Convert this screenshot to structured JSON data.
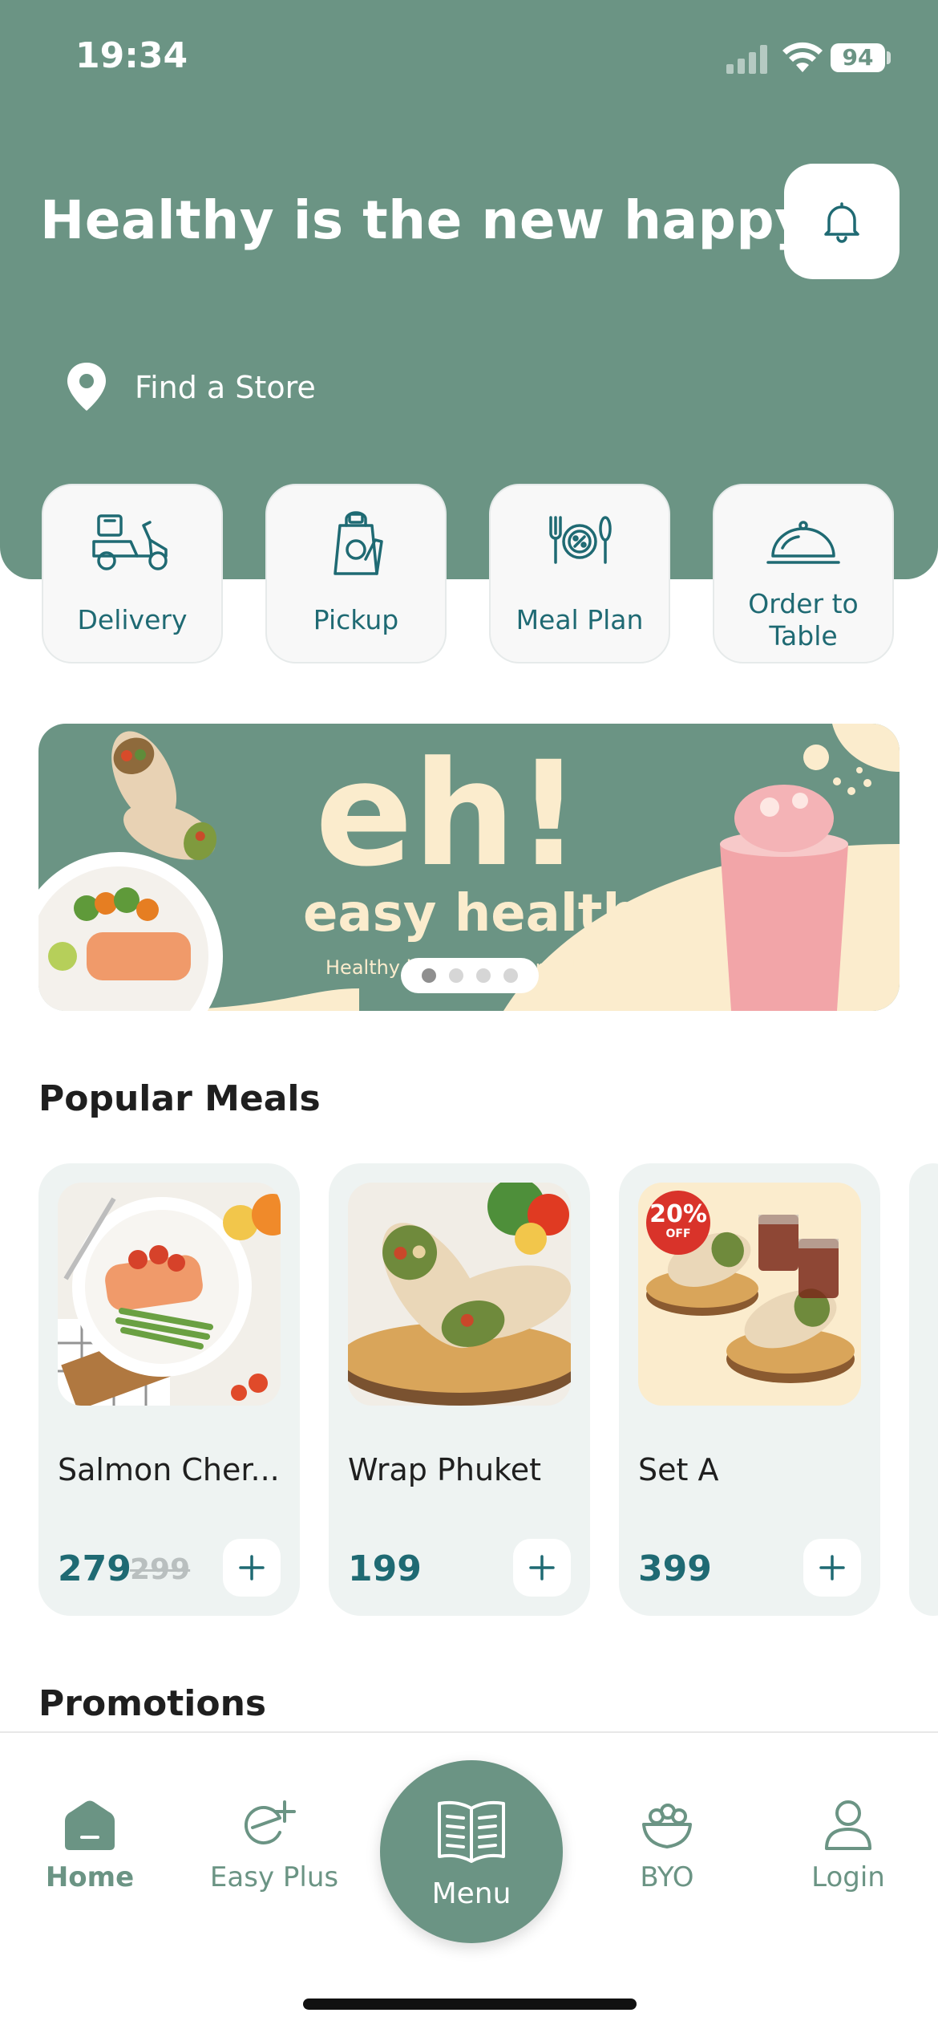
{
  "status_bar": {
    "time": "19:34",
    "battery": "94"
  },
  "header": {
    "headline": "Healthy is the new happy!",
    "find_store": "Find a Store"
  },
  "services": [
    {
      "label": "Delivery",
      "icon": "scooter-icon"
    },
    {
      "label": "Pickup",
      "icon": "bag-icon"
    },
    {
      "label": "Meal Plan",
      "icon": "meal-plan-icon"
    },
    {
      "label": "Order to Table",
      "icon": "cloche-icon"
    }
  ],
  "banner": {
    "brand": "eh!",
    "title": "easy health",
    "tagline": "Healthy is the new happy!",
    "slides": 4,
    "active_slide": 1
  },
  "popular": {
    "title": "Popular Meals",
    "items": [
      {
        "name": "Salmon Cher...",
        "price": "279",
        "old_price": "299"
      },
      {
        "name": "Wrap Phuket",
        "price": "199"
      },
      {
        "name": "Set A",
        "price": "399",
        "badge_pct": "20%",
        "badge_off": "OFF"
      }
    ]
  },
  "promotions": {
    "title": "Promotions"
  },
  "tabbar": {
    "home": "Home",
    "easy_plus": "Easy Plus",
    "menu": "Menu",
    "byo": "BYO",
    "login": "Login"
  },
  "colors": {
    "primary": "#6b9484",
    "accent_text": "#1f6a73",
    "cream": "#fbeccd"
  }
}
